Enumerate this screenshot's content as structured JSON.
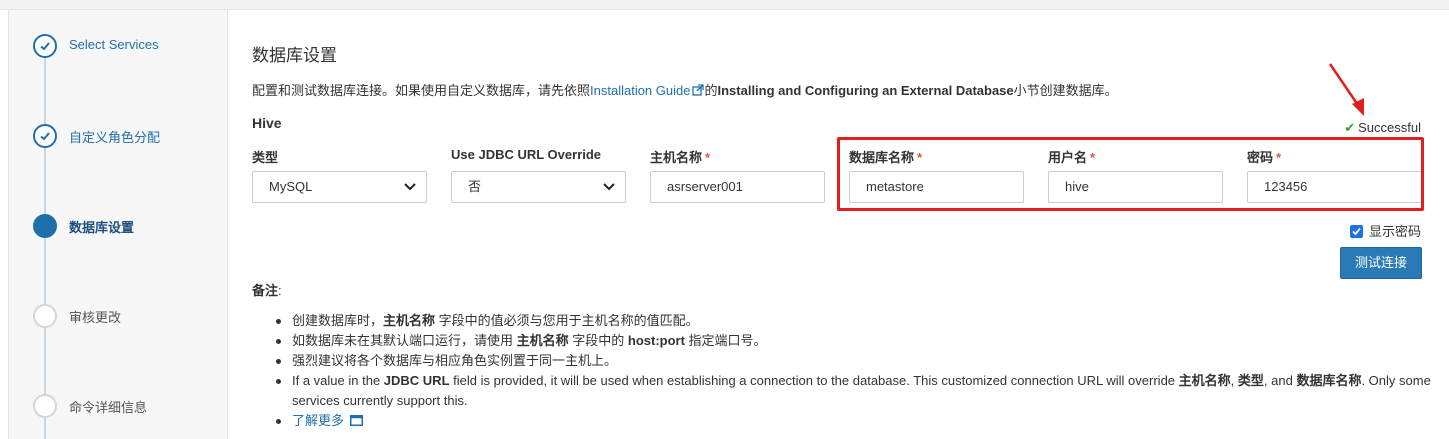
{
  "sidebar": {
    "steps": [
      {
        "label": "Select Services",
        "state": "done"
      },
      {
        "label": "自定义角色分配",
        "state": "done"
      },
      {
        "label": "数据库设置",
        "state": "current"
      },
      {
        "label": "审核更改",
        "state": "todo"
      },
      {
        "label": "命令详细信息",
        "state": "todo"
      }
    ]
  },
  "main": {
    "title": "数据库设置",
    "intro": {
      "prefix": "配置和测试数据库连接。如果使用自定义数据库，请先依照",
      "link": "Installation Guide",
      "mid": "的",
      "bold": "Installing and Configuring an External Database",
      "suffix": "小节创建数据库。"
    },
    "section": "Hive",
    "status": "Successful",
    "fields": [
      {
        "label": "类型",
        "required": false,
        "value": "MySQL",
        "type": "select"
      },
      {
        "label": "Use JDBC URL Override",
        "required": false,
        "value": "否",
        "type": "select"
      },
      {
        "label": "主机名称",
        "required": true,
        "value": "asrserver001",
        "type": "input"
      },
      {
        "label": "数据库名称",
        "required": true,
        "value": "metastore",
        "type": "input"
      },
      {
        "label": "用户名",
        "required": true,
        "value": "hive",
        "type": "input"
      },
      {
        "label": "密码",
        "required": true,
        "value": "123456",
        "type": "input"
      }
    ],
    "required_mark": "*",
    "show_password": {
      "label": "显示密码",
      "checked": true
    },
    "test_button": "测试连接",
    "notes": {
      "title": "备注",
      "colon": ":",
      "items": [
        {
          "a": "创建数据库时，",
          "b": "主机名称",
          "c": " 字段中的值必须与您用于主机名称的值匹配。"
        },
        {
          "a": "如数据库未在其默认端口运行，请使用 ",
          "b": "主机名称",
          "c": " 字段中的 ",
          "d": "host:port",
          "e": " 指定端口号。"
        },
        {
          "a": "强烈建议将各个数据库与相应角色实例置于同一主机上。"
        },
        {
          "a": "If a value in the ",
          "b": "JDBC URL",
          "c": " field is provided, it will be used when establishing a connection to the database. This customized connection URL will override ",
          "d": "主机名称",
          "e": ", ",
          "f": "类型",
          "g": ", and ",
          "h": "数据库名称",
          "i": ". Only some services currently support this."
        },
        {
          "link": "了解更多"
        }
      ]
    }
  },
  "colors": {
    "accent": "#1f6fad",
    "highlight": "#e02020",
    "success": "#3c9a3c"
  }
}
